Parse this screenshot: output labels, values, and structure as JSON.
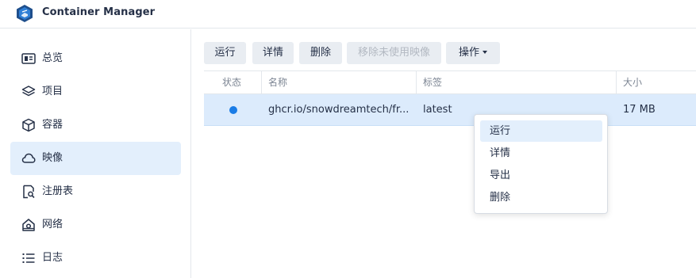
{
  "app": {
    "title": "Container Manager",
    "logo_icon": "container-manager-logo-icon",
    "accent_color": "#1a7ce6"
  },
  "sidebar": {
    "items": [
      {
        "label": "总览",
        "icon": "overview-icon",
        "active": false
      },
      {
        "label": "项目",
        "icon": "layers-icon",
        "active": false
      },
      {
        "label": "容器",
        "icon": "cube-icon",
        "active": false
      },
      {
        "label": "映像",
        "icon": "cloud-icon",
        "active": true
      },
      {
        "label": "注册表",
        "icon": "registry-search-icon",
        "active": false
      },
      {
        "label": "网络",
        "icon": "network-icon",
        "active": false
      },
      {
        "label": "日志",
        "icon": "log-list-icon",
        "active": false
      }
    ]
  },
  "toolbar": {
    "run_label": "运行",
    "details_label": "详情",
    "delete_label": "删除",
    "remove_unused_label": "移除未使用映像",
    "actions_label": "操作"
  },
  "table": {
    "columns": [
      "状态",
      "名称",
      "标签",
      "大小"
    ],
    "rows": [
      {
        "status": "running",
        "name": "ghcr.io/snowdreamtech/fr...",
        "tag": "latest",
        "size": "17 MB",
        "selected": true
      }
    ]
  },
  "context_menu": {
    "items": [
      "运行",
      "详情",
      "导出",
      "删除"
    ],
    "hovered_index": 0
  }
}
